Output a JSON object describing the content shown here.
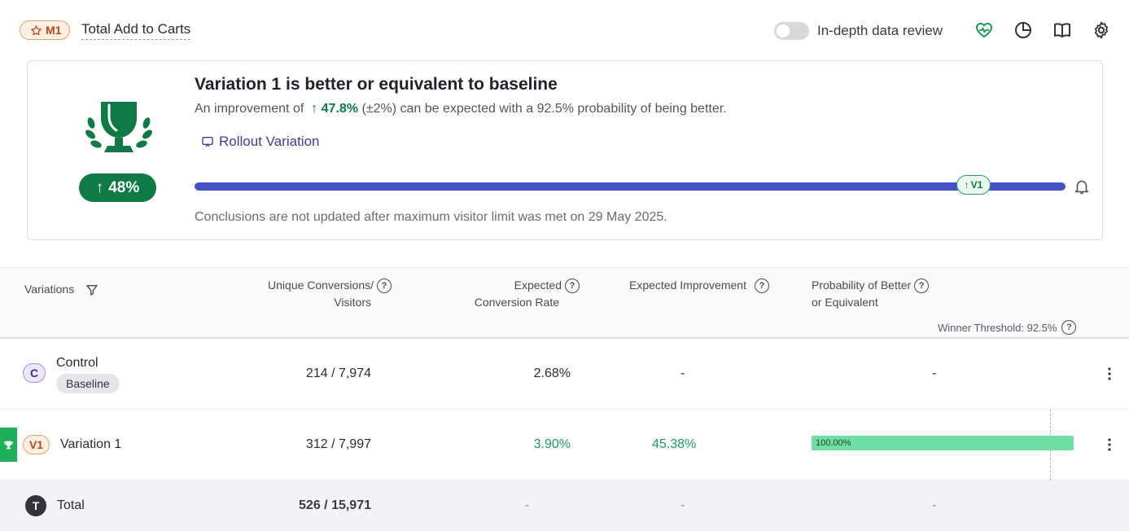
{
  "header": {
    "metric_badge": "M1",
    "metric_title": "Total Add to Carts",
    "toggle_label": "In-depth data review",
    "icons": [
      "health-heart-icon",
      "pie-chart-icon",
      "book-icon",
      "gear-icon"
    ]
  },
  "summary": {
    "title": "Variation 1 is better or equivalent to baseline",
    "sub_prefix": "An improvement of",
    "improvement": "47.8%",
    "sub_suffix": "(±2%) can be expected with a 92.5% probability of being better.",
    "lift_pill": "48%",
    "rollout_label": "Rollout Variation",
    "progress_chip": "V1",
    "note": "Conclusions are not updated after maximum visitor limit was met on 29 May 2025."
  },
  "table": {
    "headers": {
      "variations": "Variations",
      "conversions_line1": "Unique Conversions/",
      "conversions_line2": "Visitors",
      "rate_line1": "Expected",
      "rate_line2": "Conversion Rate",
      "improvement": "Expected Improvement",
      "probability_line1": "Probability of Better",
      "probability_line2": "or Equivalent",
      "threshold": "Winner Threshold: 92.5%"
    },
    "rows": [
      {
        "avatar": "C",
        "name": "Control",
        "tag": "Baseline",
        "conversions": "214 / 7,974",
        "rate": "2.68%",
        "improvement": "-",
        "probability": "-"
      },
      {
        "avatar": "V1",
        "name": "Variation 1",
        "conversions": "312 / 7,997",
        "rate": "3.90%",
        "improvement": "45.38%",
        "probability_label": "100.00%",
        "probability_value": 1.0
      }
    ],
    "total": {
      "avatar": "T",
      "name": "Total",
      "conversions": "526 / 15,971",
      "rate": "-",
      "improvement": "-",
      "probability": "-"
    }
  },
  "colors": {
    "accent_green": "#0f7a45",
    "progress_blue": "#4451c4",
    "prob_bar": "#6ee0a6"
  }
}
